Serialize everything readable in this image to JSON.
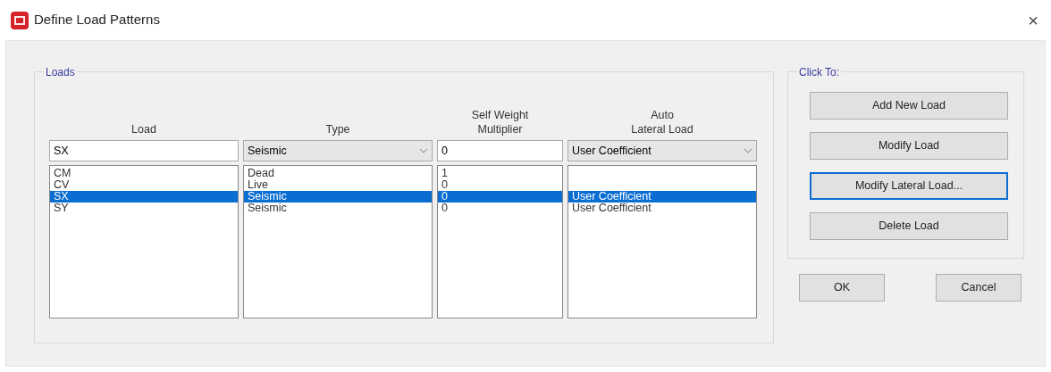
{
  "window": {
    "title": "Define Load Patterns",
    "close": "×"
  },
  "loads_group": {
    "title": "Loads",
    "columns": [
      {
        "heading": [
          "Load"
        ]
      },
      {
        "heading": [
          "Type"
        ]
      },
      {
        "heading": [
          "Self Weight",
          "Multiplier"
        ]
      },
      {
        "heading": [
          "Auto",
          "Lateral Load"
        ]
      }
    ],
    "editors": [
      {
        "kind": "text",
        "value": "SX"
      },
      {
        "kind": "combo",
        "value": "Seismic"
      },
      {
        "kind": "text",
        "value": "0"
      },
      {
        "kind": "combo",
        "value": "User Coefficient"
      }
    ],
    "rows": [
      {
        "load": "CM",
        "type": "Dead",
        "multiplier": "1",
        "selected": false
      },
      {
        "load": "CV",
        "type": "Live",
        "multiplier": "0",
        "selected": false
      },
      {
        "load": "SX",
        "type": "Seismic",
        "multiplier": "0",
        "auto_lateral": "User Coefficient",
        "selected": true
      },
      {
        "load": "SY",
        "type": "Seismic",
        "multiplier": "0",
        "auto_lateral": "User Coefficient",
        "selected": false
      }
    ]
  },
  "click_to": {
    "title": "Click To:",
    "buttons": [
      {
        "label": "Add New Load",
        "focused": false
      },
      {
        "label": "Modify Load",
        "focused": false
      },
      {
        "label": "Modify Lateral Load...",
        "focused": true
      },
      {
        "label": "Delete Load",
        "focused": false
      }
    ]
  },
  "dialog_buttons": [
    {
      "label": "OK"
    },
    {
      "label": "Cancel"
    }
  ]
}
